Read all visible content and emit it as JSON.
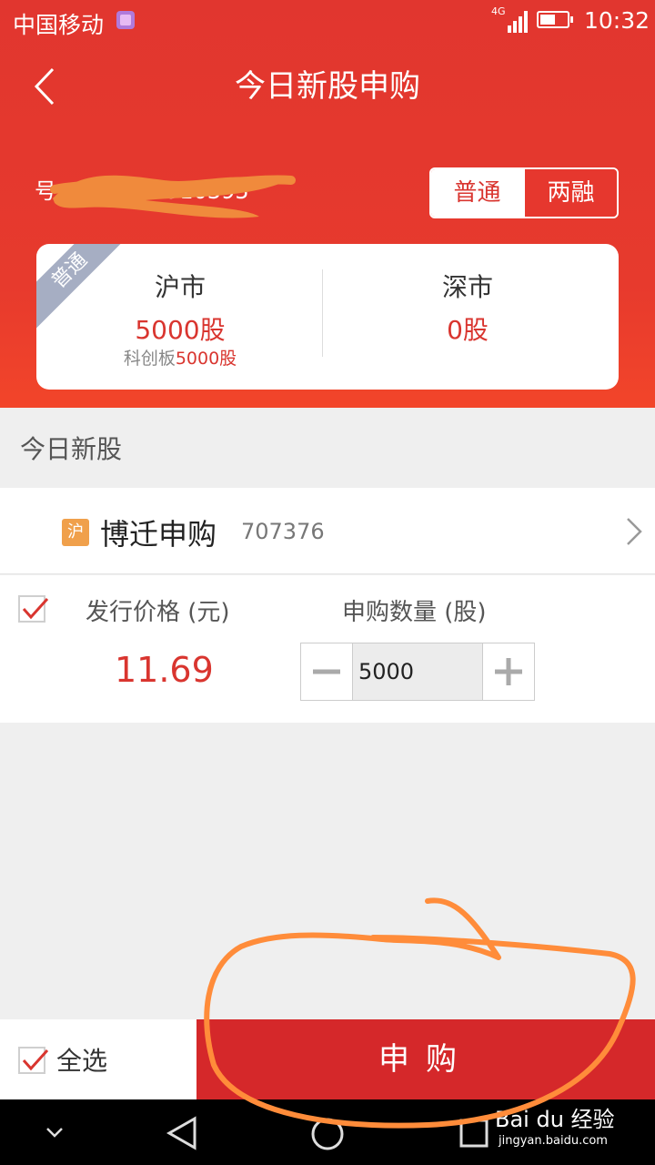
{
  "status_bar": {
    "carrier": "中国移动",
    "network": "4G",
    "time": "10:32"
  },
  "header": {
    "title": "今日新股申购",
    "account_visible": "号",
    "account_tail": "910395"
  },
  "toggle": {
    "option1": "普通",
    "option2": "两融"
  },
  "quota_card": {
    "ribbon": "普通",
    "sh": {
      "name": "沪市",
      "value": "5000股",
      "sub_label": "科创板",
      "sub_value": "5000股"
    },
    "sz": {
      "name": "深市",
      "value": "0股"
    }
  },
  "section": {
    "label": "今日新股"
  },
  "stock": {
    "badge": "沪",
    "name": "博迁申购",
    "code": "707376"
  },
  "detail": {
    "price_label": "发行价格 (元)",
    "qty_label": "申购数量 (股)",
    "price": "11.69",
    "qty": "5000"
  },
  "bottom": {
    "select_all": "全选",
    "apply": "申购"
  },
  "watermark": {
    "brand": "Bai du 经验",
    "url": "jingyan.baidu.com"
  },
  "colors": {
    "primary_red": "#d9352f",
    "header_red": "#e1362f",
    "annotation_orange": "#ff8c3a"
  },
  "icons": [
    "back-icon",
    "sim-icon",
    "signal-icon",
    "battery-icon",
    "chevron-right-icon",
    "check-icon",
    "minus-icon",
    "plus-icon",
    "nav-down-icon",
    "nav-back-icon",
    "nav-home-icon",
    "nav-recents-icon"
  ]
}
